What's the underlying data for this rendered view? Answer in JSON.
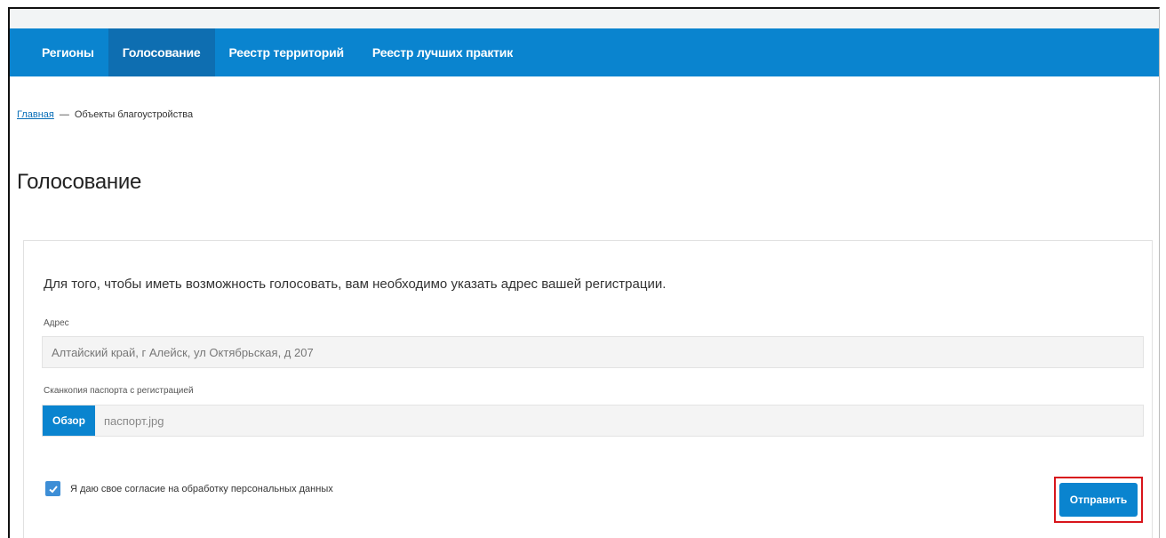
{
  "nav": {
    "items": [
      {
        "label": "Регионы",
        "active": false
      },
      {
        "label": "Голосование",
        "active": true
      },
      {
        "label": "Реестр территорий",
        "active": false
      },
      {
        "label": "Реестр лучших практик",
        "active": false
      }
    ]
  },
  "breadcrumb": {
    "home": "Главная",
    "separator": "—",
    "current": "Объекты благоустройства"
  },
  "page": {
    "title": "Голосование"
  },
  "form": {
    "intro": "Для того, чтобы иметь возможность голосовать, вам необходимо указать адрес вашей регистрации.",
    "address_label": "Адрес",
    "address_value": "Алтайский край, г Алейск, ул Октябрьская, д 207",
    "scan_label": "Сканкопия паспорта с регистрацией",
    "browse_label": "Обзор",
    "file_name": "паспорт.jpg",
    "consent_label": "Я даю свое согласие на обработку персональных данных",
    "consent_checked": true,
    "submit_label": "Отправить"
  },
  "colors": {
    "nav_bg": "#0a84cf",
    "nav_active": "#0e6eb1",
    "highlight": "#d8151b"
  }
}
